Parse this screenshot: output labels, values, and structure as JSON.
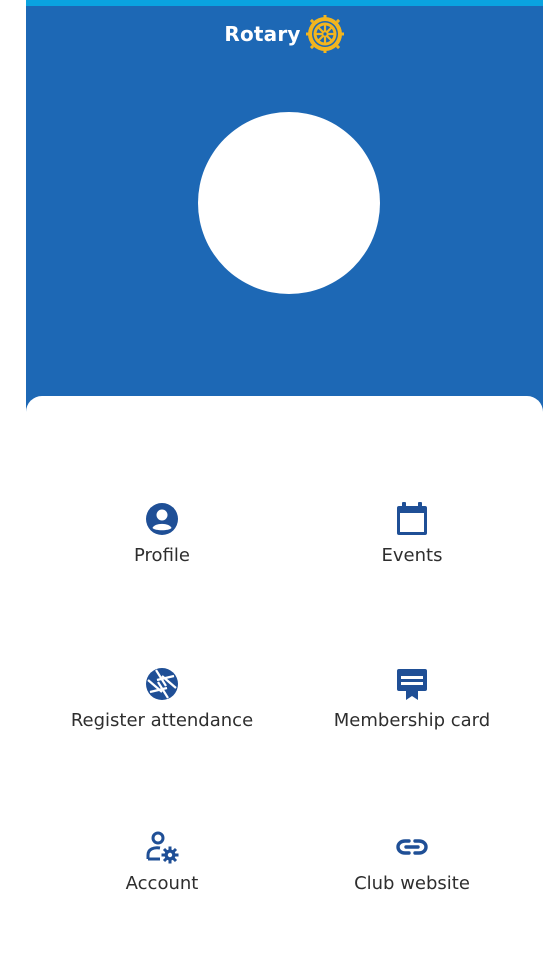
{
  "header": {
    "brand_text": "Rotary",
    "logo_icon": "rotary-wheel-icon",
    "avatar": "profile-avatar-placeholder"
  },
  "menu": {
    "items": [
      {
        "label": "Profile",
        "icon": "user-circle-icon"
      },
      {
        "label": "Events",
        "icon": "calendar-icon"
      },
      {
        "label": "Register attendance",
        "icon": "camera-aperture-icon"
      },
      {
        "label": "Membership card",
        "icon": "membership-card-icon"
      },
      {
        "label": "Account",
        "icon": "user-settings-icon"
      },
      {
        "label": "Club website",
        "icon": "link-icon"
      }
    ]
  },
  "colors": {
    "header_blue": "#1d68b5",
    "top_strip": "#0aa3e0",
    "icon_blue": "#1f4f96",
    "rotary_gold": "#f2b51e"
  }
}
